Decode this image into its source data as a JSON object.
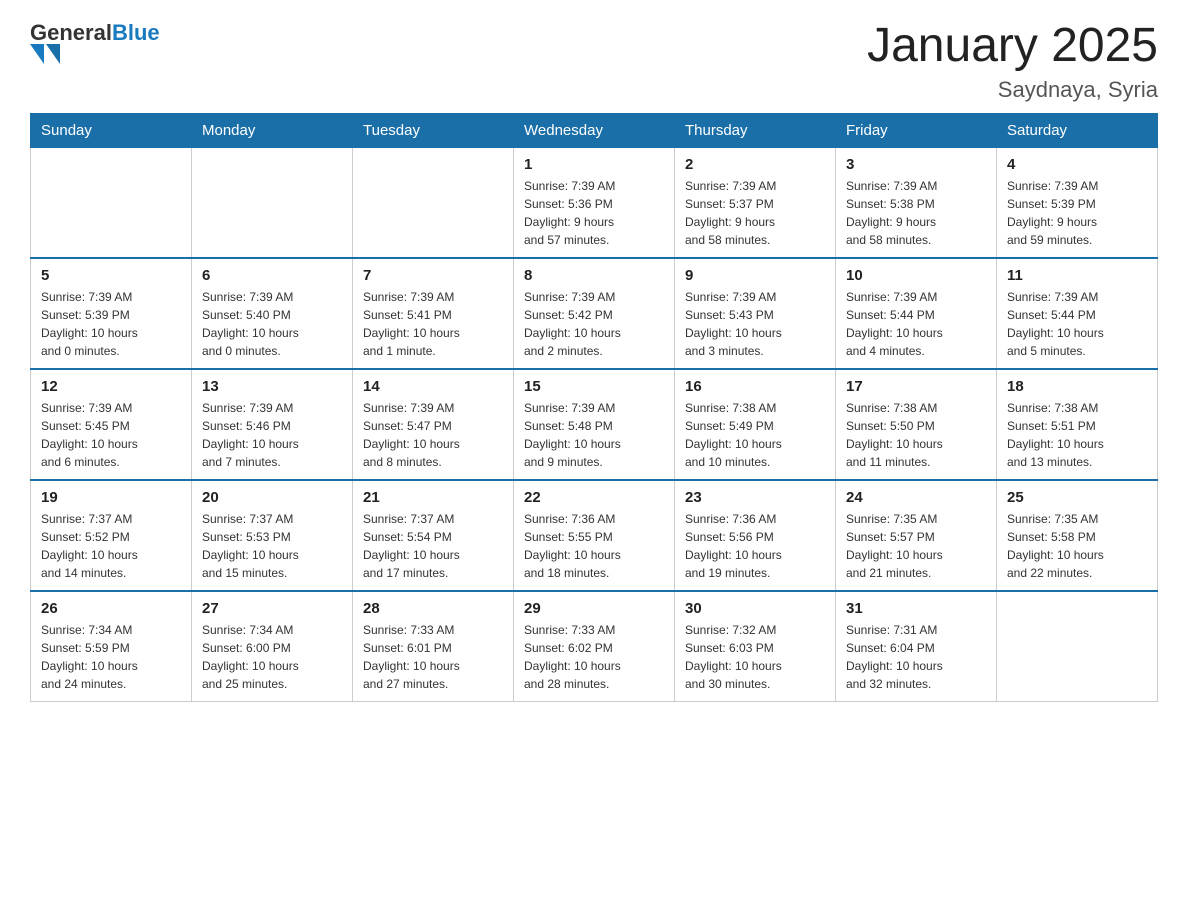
{
  "header": {
    "logo_general": "General",
    "logo_blue": "Blue",
    "title": "January 2025",
    "subtitle": "Saydnaya, Syria"
  },
  "days_of_week": [
    "Sunday",
    "Monday",
    "Tuesday",
    "Wednesday",
    "Thursday",
    "Friday",
    "Saturday"
  ],
  "weeks": [
    [
      {
        "day": "",
        "info": ""
      },
      {
        "day": "",
        "info": ""
      },
      {
        "day": "",
        "info": ""
      },
      {
        "day": "1",
        "info": "Sunrise: 7:39 AM\nSunset: 5:36 PM\nDaylight: 9 hours\nand 57 minutes."
      },
      {
        "day": "2",
        "info": "Sunrise: 7:39 AM\nSunset: 5:37 PM\nDaylight: 9 hours\nand 58 minutes."
      },
      {
        "day": "3",
        "info": "Sunrise: 7:39 AM\nSunset: 5:38 PM\nDaylight: 9 hours\nand 58 minutes."
      },
      {
        "day": "4",
        "info": "Sunrise: 7:39 AM\nSunset: 5:39 PM\nDaylight: 9 hours\nand 59 minutes."
      }
    ],
    [
      {
        "day": "5",
        "info": "Sunrise: 7:39 AM\nSunset: 5:39 PM\nDaylight: 10 hours\nand 0 minutes."
      },
      {
        "day": "6",
        "info": "Sunrise: 7:39 AM\nSunset: 5:40 PM\nDaylight: 10 hours\nand 0 minutes."
      },
      {
        "day": "7",
        "info": "Sunrise: 7:39 AM\nSunset: 5:41 PM\nDaylight: 10 hours\nand 1 minute."
      },
      {
        "day": "8",
        "info": "Sunrise: 7:39 AM\nSunset: 5:42 PM\nDaylight: 10 hours\nand 2 minutes."
      },
      {
        "day": "9",
        "info": "Sunrise: 7:39 AM\nSunset: 5:43 PM\nDaylight: 10 hours\nand 3 minutes."
      },
      {
        "day": "10",
        "info": "Sunrise: 7:39 AM\nSunset: 5:44 PM\nDaylight: 10 hours\nand 4 minutes."
      },
      {
        "day": "11",
        "info": "Sunrise: 7:39 AM\nSunset: 5:44 PM\nDaylight: 10 hours\nand 5 minutes."
      }
    ],
    [
      {
        "day": "12",
        "info": "Sunrise: 7:39 AM\nSunset: 5:45 PM\nDaylight: 10 hours\nand 6 minutes."
      },
      {
        "day": "13",
        "info": "Sunrise: 7:39 AM\nSunset: 5:46 PM\nDaylight: 10 hours\nand 7 minutes."
      },
      {
        "day": "14",
        "info": "Sunrise: 7:39 AM\nSunset: 5:47 PM\nDaylight: 10 hours\nand 8 minutes."
      },
      {
        "day": "15",
        "info": "Sunrise: 7:39 AM\nSunset: 5:48 PM\nDaylight: 10 hours\nand 9 minutes."
      },
      {
        "day": "16",
        "info": "Sunrise: 7:38 AM\nSunset: 5:49 PM\nDaylight: 10 hours\nand 10 minutes."
      },
      {
        "day": "17",
        "info": "Sunrise: 7:38 AM\nSunset: 5:50 PM\nDaylight: 10 hours\nand 11 minutes."
      },
      {
        "day": "18",
        "info": "Sunrise: 7:38 AM\nSunset: 5:51 PM\nDaylight: 10 hours\nand 13 minutes."
      }
    ],
    [
      {
        "day": "19",
        "info": "Sunrise: 7:37 AM\nSunset: 5:52 PM\nDaylight: 10 hours\nand 14 minutes."
      },
      {
        "day": "20",
        "info": "Sunrise: 7:37 AM\nSunset: 5:53 PM\nDaylight: 10 hours\nand 15 minutes."
      },
      {
        "day": "21",
        "info": "Sunrise: 7:37 AM\nSunset: 5:54 PM\nDaylight: 10 hours\nand 17 minutes."
      },
      {
        "day": "22",
        "info": "Sunrise: 7:36 AM\nSunset: 5:55 PM\nDaylight: 10 hours\nand 18 minutes."
      },
      {
        "day": "23",
        "info": "Sunrise: 7:36 AM\nSunset: 5:56 PM\nDaylight: 10 hours\nand 19 minutes."
      },
      {
        "day": "24",
        "info": "Sunrise: 7:35 AM\nSunset: 5:57 PM\nDaylight: 10 hours\nand 21 minutes."
      },
      {
        "day": "25",
        "info": "Sunrise: 7:35 AM\nSunset: 5:58 PM\nDaylight: 10 hours\nand 22 minutes."
      }
    ],
    [
      {
        "day": "26",
        "info": "Sunrise: 7:34 AM\nSunset: 5:59 PM\nDaylight: 10 hours\nand 24 minutes."
      },
      {
        "day": "27",
        "info": "Sunrise: 7:34 AM\nSunset: 6:00 PM\nDaylight: 10 hours\nand 25 minutes."
      },
      {
        "day": "28",
        "info": "Sunrise: 7:33 AM\nSunset: 6:01 PM\nDaylight: 10 hours\nand 27 minutes."
      },
      {
        "day": "29",
        "info": "Sunrise: 7:33 AM\nSunset: 6:02 PM\nDaylight: 10 hours\nand 28 minutes."
      },
      {
        "day": "30",
        "info": "Sunrise: 7:32 AM\nSunset: 6:03 PM\nDaylight: 10 hours\nand 30 minutes."
      },
      {
        "day": "31",
        "info": "Sunrise: 7:31 AM\nSunset: 6:04 PM\nDaylight: 10 hours\nand 32 minutes."
      },
      {
        "day": "",
        "info": ""
      }
    ]
  ]
}
